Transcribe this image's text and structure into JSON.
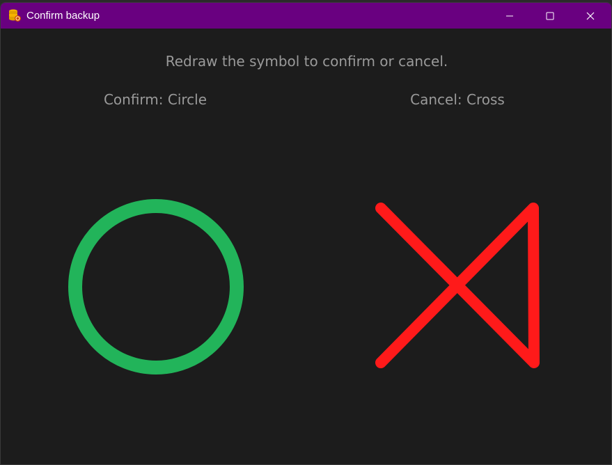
{
  "window": {
    "title": "Confirm backup",
    "titlebar_color": "#690080",
    "background_color": "#1c1c1c",
    "app_icon": "database-icon",
    "controls": {
      "minimize_icon": "minimize-icon",
      "maximize_icon": "maximize-icon",
      "close_icon": "close-icon"
    }
  },
  "prompt": {
    "instruction": "Redraw the symbol to confirm or cancel.",
    "confirm_label": "Confirm: Circle",
    "cancel_label": "Cancel: Cross"
  },
  "symbols": {
    "confirm": {
      "shape": "circle",
      "color": "#22b45a"
    },
    "cancel": {
      "shape": "cross",
      "color": "#ff1a1a"
    }
  }
}
